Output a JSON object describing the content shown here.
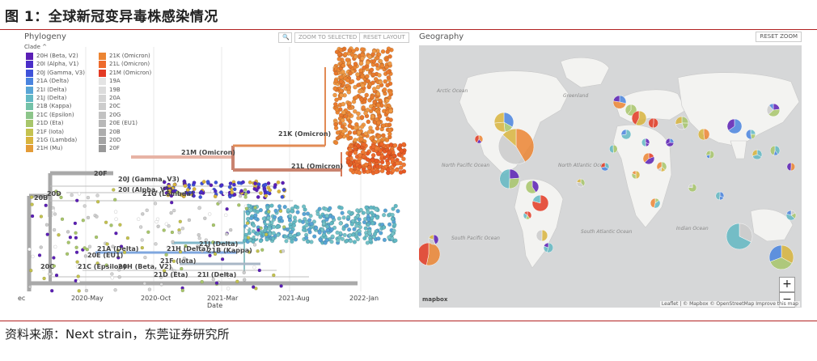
{
  "figure": {
    "title": "图 1：全球新冠变异毒株感染情况",
    "source": "资料来源：Next strain，东莞证券研究所"
  },
  "phylogeny": {
    "title": "Phylogeny",
    "zoom_selected_label": "ZOOM TO SELECTED",
    "reset_layout_label": "RESET LAYOUT",
    "clade_header": "Clade",
    "legend_left": [
      {
        "label": "20H (Beta, V2)",
        "color": "#5b1fb5"
      },
      {
        "label": "20I (Alpha, V1)",
        "color": "#4a2ec9"
      },
      {
        "label": "20J (Gamma, V3)",
        "color": "#3f52d9"
      },
      {
        "label": "21A (Delta)",
        "color": "#4a84df"
      },
      {
        "label": "21I (Delta)",
        "color": "#58a5d6"
      },
      {
        "label": "21J (Delta)",
        "color": "#63b9c4"
      },
      {
        "label": "21B (Kappa)",
        "color": "#74c2a8"
      },
      {
        "label": "21C (Epsilon)",
        "color": "#8cc58a"
      },
      {
        "label": "21D (Eta)",
        "color": "#a8c66b"
      },
      {
        "label": "21F (Iota)",
        "color": "#c4c24f"
      },
      {
        "label": "21G (Lambda)",
        "color": "#d8b43e"
      },
      {
        "label": "21H (Mu)",
        "color": "#e49c38"
      }
    ],
    "legend_right": [
      {
        "label": "21K (Omicron)",
        "color": "#ec8533"
      },
      {
        "label": "21L (Omicron)",
        "color": "#ee6a2c"
      },
      {
        "label": "21M (Omicron)",
        "color": "#e33a24"
      },
      {
        "label": "19A",
        "color": "#e4e4e4"
      },
      {
        "label": "19B",
        "color": "#dcdcdc"
      },
      {
        "label": "20A",
        "color": "#d4d4d4"
      },
      {
        "label": "20C",
        "color": "#cccccc"
      },
      {
        "label": "20G",
        "color": "#c2c2c2"
      },
      {
        "label": "20E (EU1)",
        "color": "#b8b8b8"
      },
      {
        "label": "20B",
        "color": "#adadad"
      },
      {
        "label": "20D",
        "color": "#a4a4a4"
      },
      {
        "label": "20F",
        "color": "#999999"
      }
    ],
    "tree_labels": {
      "k21": "21K (Omicron)",
      "m21": "21M (Omicron)",
      "l21": "21L (Omicron)",
      "f20": "20F",
      "j20": "20J (Gamma, V3)",
      "i20": "20I (Alpha, V1)",
      "g21": "21G (Lambda)",
      "b20": "20B",
      "d20": "20D",
      "a21": "21A (Delta)",
      "j21": "21J (Delta)",
      "h21": "21H (Delta)",
      "b21": "21B (Kappa)",
      "e20": "20E (EU1)",
      "f21": "21F (Iota)",
      "c20": "20C",
      "c21": "21C (Epsilon)",
      "h20": "20H (Beta, V2)",
      "d21": "21D (Eta)",
      "i21": "21I (Delta)"
    },
    "x_axis": {
      "ticks": [
        "ec",
        "2020-May",
        "2020-Oct",
        "2021-Mar",
        "2021-Aug",
        "2022-Jan"
      ],
      "label": "Date"
    }
  },
  "geography": {
    "title": "Geography",
    "reset_zoom_label": "RESET ZOOM",
    "zoom_in": "+",
    "zoom_out": "−",
    "mapbox_logo": "mapbox",
    "attribution": "Leaflet | © Mapbox © OpenStreetMap Improve this map",
    "ocean_labels": {
      "arctic": "Arctic Ocean",
      "north_pacific": "North Pacific Ocean",
      "north_atlantic": "North Atlantic Ocean",
      "south_pacific": "South Pacific Ocean",
      "south_atlantic": "South Atlantic Ocean",
      "indian": "Indian Ocean",
      "greenland": "Greenland"
    }
  }
}
